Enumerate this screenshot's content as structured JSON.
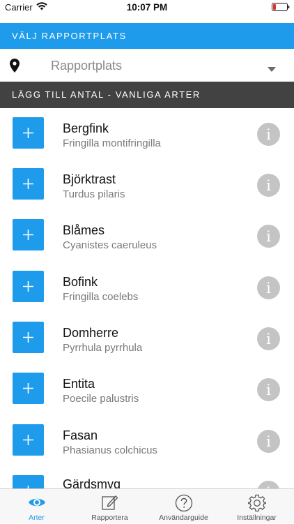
{
  "status_bar": {
    "carrier": "Carrier",
    "time": "10:07 PM"
  },
  "header": {
    "title": "VÄLJ RAPPORTPLATS"
  },
  "location_picker": {
    "placeholder": "Rapportplats",
    "icon": "location-pin-icon"
  },
  "section": {
    "title": "LÄGG TILL ANTAL - VANLIGA ARTER"
  },
  "species": [
    {
      "name": "Bergfink",
      "latin": "Fringilla montifringilla"
    },
    {
      "name": "Björktrast",
      "latin": "Turdus pilaris"
    },
    {
      "name": "Blåmes",
      "latin": "Cyanistes caeruleus"
    },
    {
      "name": "Bofink",
      "latin": "Fringilla coelebs"
    },
    {
      "name": "Domherre",
      "latin": "Pyrrhula pyrrhula"
    },
    {
      "name": "Entita",
      "latin": "Poecile palustris"
    },
    {
      "name": "Fasan",
      "latin": "Phasianus colchicus"
    },
    {
      "name": "Gärdsmyg",
      "latin": ""
    }
  ],
  "info_glyph": "i",
  "tabs": [
    {
      "label": "Arter",
      "icon": "eye-icon",
      "active": true
    },
    {
      "label": "Rapportera",
      "icon": "edit-icon",
      "active": false
    },
    {
      "label": "Användarguide",
      "icon": "help-icon",
      "active": false
    },
    {
      "label": "Inställningar",
      "icon": "gear-icon",
      "active": false
    }
  ],
  "colors": {
    "accent": "#1E9BEA",
    "section_bg": "#424242",
    "info_gray": "#c4c4c4",
    "battery_red": "#e0302a"
  }
}
